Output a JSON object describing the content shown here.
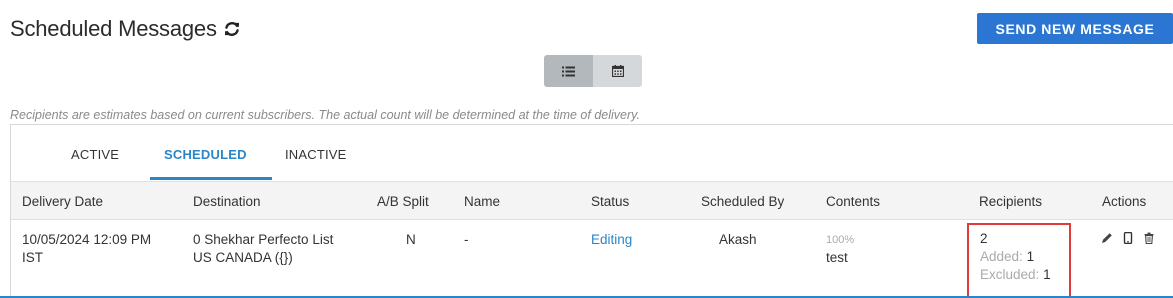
{
  "header": {
    "title": "Scheduled Messages",
    "send_button": "SEND NEW MESSAGE"
  },
  "icons": {
    "refresh": "refresh-icon",
    "list_view": "list-icon",
    "calendar_view": "calendar-icon",
    "edit": "pencil-icon",
    "preview": "mobile-phone-icon",
    "delete": "trash-icon"
  },
  "note": "Recipients are estimates based on current subscribers. The actual count will be determined at the time of delivery.",
  "tabs": [
    {
      "label": "ACTIVE"
    },
    {
      "label": "SCHEDULED"
    },
    {
      "label": "INACTIVE"
    }
  ],
  "selected_tab": "SCHEDULED",
  "table": {
    "columns": [
      "Delivery Date",
      "Destination",
      "A/B Split",
      "Name",
      "Status",
      "Scheduled By",
      "Contents",
      "Recipients",
      "Actions"
    ],
    "rows": [
      {
        "delivery_date_line1": "10/05/2024 12:09 PM",
        "delivery_date_line2": "IST",
        "destination_line1": "0 Shekhar Perfecto List",
        "destination_line2": "US CANADA ({})",
        "ab_split": "N",
        "name": "-",
        "status": "Editing",
        "scheduled_by": "Akash",
        "contents_percent": "100%",
        "contents_text": "test",
        "recipients_total": "2",
        "added_label": "Added:",
        "added_value": "1",
        "excluded_label": "Excluded:",
        "excluded_value": "1"
      }
    ]
  },
  "colors": {
    "primary": "#2a76d2",
    "link": "#2a86c9",
    "highlight": "#e03a3a"
  }
}
